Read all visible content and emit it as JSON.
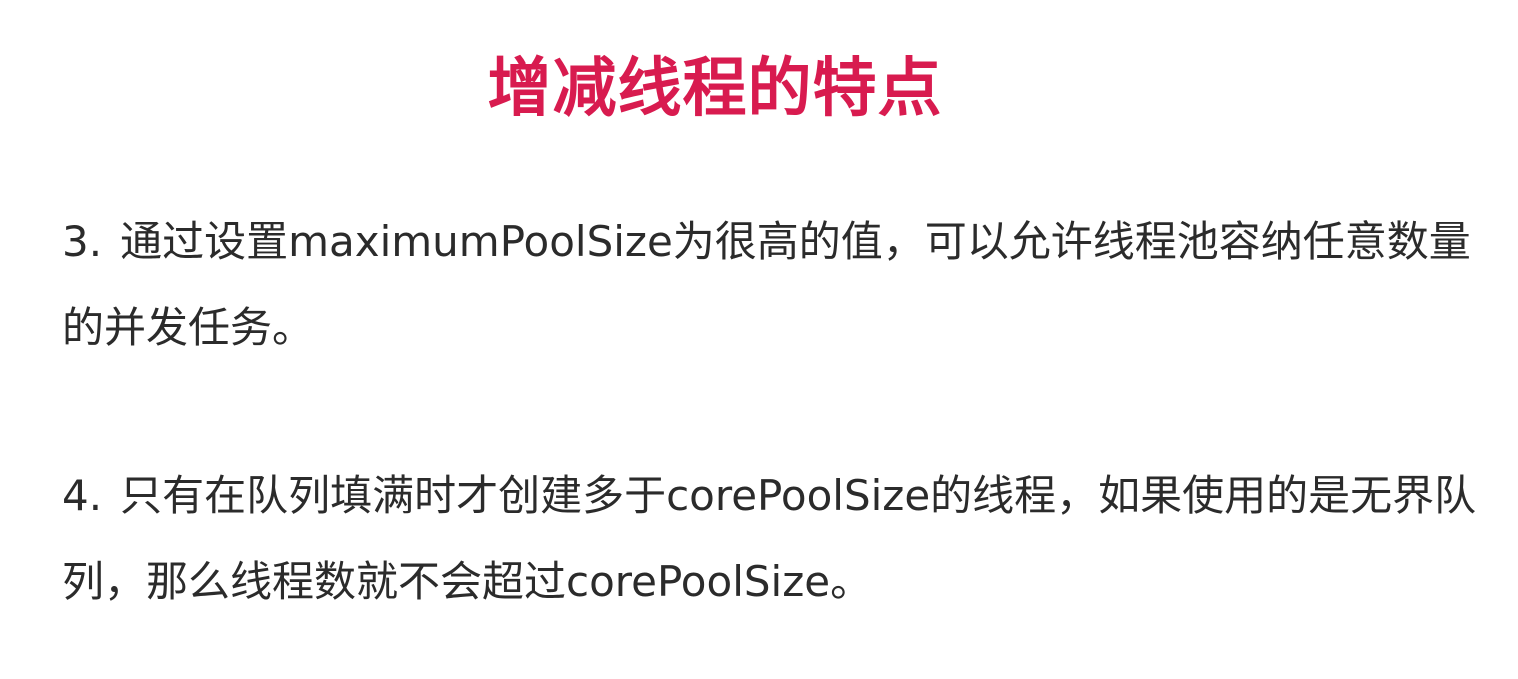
{
  "slide": {
    "title": "增减线程的特点",
    "points": [
      {
        "number": "3.",
        "text": "通过设置maximumPoolSize为很高的值，可以允许线程池容纳任意数量的并发任务。"
      },
      {
        "number": "4.",
        "text": "只有在队列填满时才创建多于corePoolSize的线程，如果使用的是无界队列，那么线程数就不会超过corePoolSize。"
      }
    ],
    "colors": {
      "title": "#d81b4f",
      "body_text": "#2b2b2b",
      "background": "#ffffff"
    }
  }
}
